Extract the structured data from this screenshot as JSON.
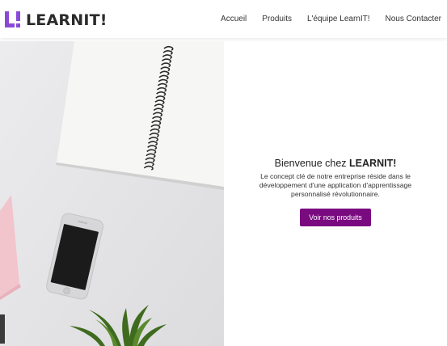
{
  "brand": {
    "logo_mark_text": "L!",
    "name": "LEARNIT!",
    "accent_color": "#8a4ad6"
  },
  "nav": {
    "items": [
      {
        "label": "Accueil"
      },
      {
        "label": "Produits"
      },
      {
        "label": "L'équipe LearnIT!"
      },
      {
        "label": "Nous Contacter"
      }
    ]
  },
  "hero": {
    "title_prefix": "Bienvenue chez ",
    "title_brand": "LEARNIT!",
    "description": "Le concept clé de notre entreprise réside dans le développement d'une application d'apprentissage personnalisé révolutionnaire.",
    "cta_label": "Voir nos produits",
    "cta_color": "#7a0a80"
  }
}
